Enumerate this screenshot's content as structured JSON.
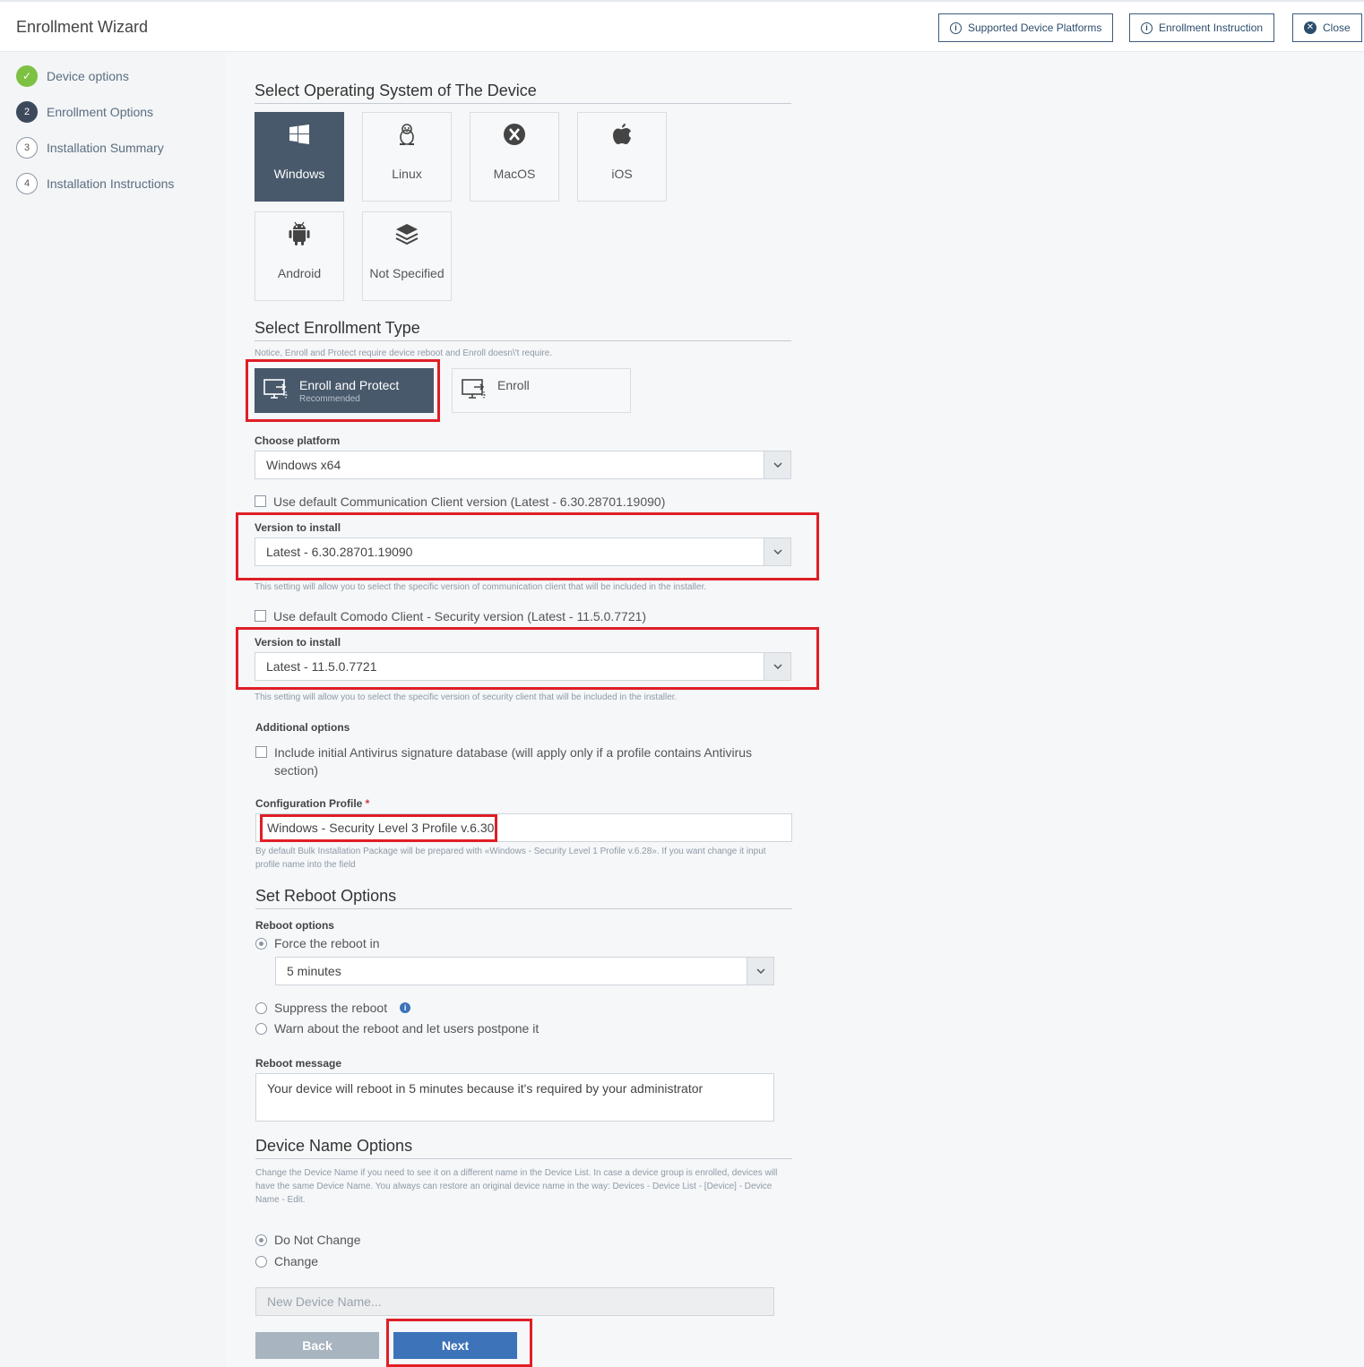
{
  "header": {
    "title": "Enrollment Wizard",
    "supported_platforms": "Supported Device Platforms",
    "enrollment_instruction": "Enrollment Instruction",
    "close": "Close"
  },
  "sidebar": {
    "steps": [
      {
        "num": "✓",
        "label": "Device options",
        "state": "done"
      },
      {
        "num": "2",
        "label": "Enrollment Options",
        "state": "active"
      },
      {
        "num": "3",
        "label": "Installation Summary",
        "state": "pending"
      },
      {
        "num": "4",
        "label": "Installation Instructions",
        "state": "pending"
      }
    ]
  },
  "os": {
    "title": "Select Operating System of The Device",
    "tiles": [
      {
        "label": "Windows",
        "icon": "windows-icon",
        "selected": true
      },
      {
        "label": "Linux",
        "icon": "linux-icon"
      },
      {
        "label": "MacOS",
        "icon": "macos-icon"
      },
      {
        "label": "iOS",
        "icon": "apple-icon"
      },
      {
        "label": "Android",
        "icon": "android-icon"
      },
      {
        "label": "Not Specified",
        "icon": "layers-icon"
      }
    ]
  },
  "enrollment": {
    "title": "Select Enrollment Type",
    "notice": "Notice, Enroll and Protect require device reboot and Enroll doesn\\'t require.",
    "protect_label": "Enroll and Protect",
    "protect_sub": "Recommended",
    "enroll_label": "Enroll"
  },
  "platform": {
    "label": "Choose platform",
    "value": "Windows x64"
  },
  "comm_client": {
    "checkbox": "Use default Communication Client version (Latest - 6.30.28701.19090)",
    "label": "Version to install",
    "value": "Latest - 6.30.28701.19090",
    "help": "This setting will allow you to select the specific version of communication client that will be included in the installer."
  },
  "sec_client": {
    "checkbox": "Use default Comodo Client - Security version (Latest - 11.5.0.7721)",
    "label": "Version to install",
    "value": "Latest - 11.5.0.7721",
    "help": "This setting will allow you to select the specific version of security client that will be included in the installer."
  },
  "additional": {
    "label": "Additional options",
    "antivirus": "Include initial Antivirus signature database (will apply only if a profile contains Antivirus section)"
  },
  "config_profile": {
    "label": "Configuration Profile",
    "required_mark": "*",
    "value": "Windows - Security Level 3 Profile v.6.30",
    "help": "By default Bulk Installation Package will be prepared with «Windows - Security Level 1 Profile v.6.28». If you want change it input profile name into the field"
  },
  "reboot": {
    "title": "Set Reboot Options",
    "label": "Reboot options",
    "force": "Force the reboot in",
    "force_value": "5 minutes",
    "suppress": "Suppress the reboot",
    "warn": "Warn about the reboot and let users postpone it",
    "msg_label": "Reboot message",
    "msg_value": "Your device will reboot in 5 minutes because it's required by your administrator"
  },
  "device_name": {
    "title": "Device Name Options",
    "help": "Change the Device Name if you need to see it on a different name in the Device List. In case a device group is enrolled, devices will have the same Device Name. You always can restore an original device name in the way: Devices - Device List - [Device] - Device Name - Edit.",
    "no_change": "Do Not Change",
    "change": "Change",
    "placeholder": "New Device Name..."
  },
  "footer": {
    "back": "Back",
    "next": "Next"
  },
  "colors": {
    "accent": "#3d73b9",
    "selected_tile": "#48596b",
    "highlight": "#e01e26",
    "done": "#7dc142"
  }
}
